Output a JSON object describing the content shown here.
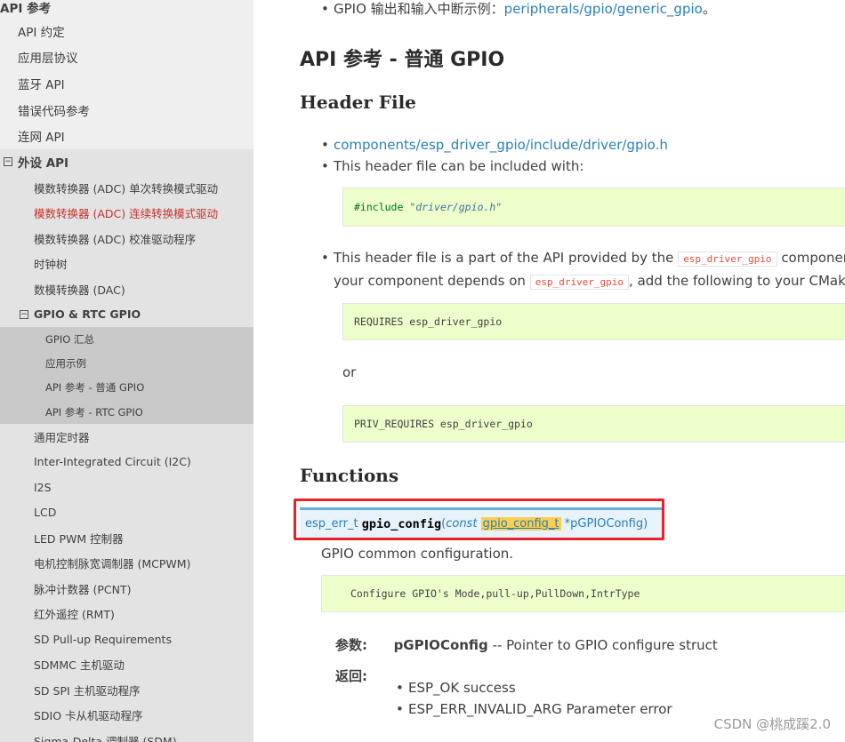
{
  "sidebar": {
    "top_item": "API 参考",
    "items_l1": [
      "API 约定",
      "应用层协议",
      "蓝牙 API",
      "错误代码参考",
      "连网 API"
    ],
    "expanded_l1": {
      "toggle": "⊟",
      "label": "外设 API"
    },
    "items_l2_before": [
      "模数转换器 (ADC) 单次转换模式驱动",
      "模数转换器 (ADC) 连续转换模式驱动",
      "模数转换器 (ADC) 校准驱动程序",
      "时钟树",
      "数模转换器 (DAC)"
    ],
    "expanded_l2": {
      "toggle": "⊟",
      "label": "GPIO & RTC GPIO"
    },
    "items_l3": [
      "GPIO 汇总",
      "应用示例",
      "API 参考 - 普通 GPIO",
      "API 参考 - RTC GPIO"
    ],
    "items_l2_after": [
      "通用定时器",
      "Inter-Integrated Circuit (I2C)",
      "I2S",
      "LCD",
      "LED PWM 控制器",
      "电机控制脉宽调制器 (MCPWM)",
      "脉冲计数器 (PCNT)",
      "红外遥控 (RMT)",
      "SD Pull-up Requirements",
      "SDMMC 主机驱动",
      "SD SPI 主机驱动程序",
      "SDIO 卡从机驱动程序",
      "Sigma-Delta 调制器 (SDM)"
    ]
  },
  "main": {
    "top_bullet_text": "GPIO 输出和输入中断示例：",
    "top_bullet_link": "peripherals/gpio/generic_gpio",
    "top_bullet_suffix": "。",
    "page_title": "API 参考 - 普通 GPIO",
    "header_file_heading": "Header File",
    "header_link": "components/esp_driver_gpio/include/driver/gpio.h",
    "include_intro": "This header file can be included with:",
    "include_directive": "#include",
    "include_path": "\"driver/gpio.h\"",
    "part_of_text_1": "This header file is a part of the API provided by the",
    "component_code": "esp_driver_gpio",
    "part_of_text_2": "component. To d",
    "depends_text_1": "your component depends on",
    "depends_text_2": ", add the following to your CMakeLists.",
    "requires_line": "REQUIRES esp_driver_gpio",
    "or_text": "or",
    "priv_requires_line": "PRIV_REQUIRES esp_driver_gpio",
    "functions_heading": "Functions",
    "signature": {
      "return_type": "esp_err_t",
      "name": "gpio_config",
      "open_paren": "(",
      "qualifier": "const",
      "param_type": "gpio_config_t",
      "param_name": "*pGPIOConfig",
      "close_paren": ")"
    },
    "description": "GPIO common configuration.",
    "code_comment": "Configure GPIO's Mode,pull-up,PullDown,IntrType",
    "params_label": "参数:",
    "param_name_bold": "pGPIOConfig",
    "param_desc": " -- Pointer to GPIO configure struct",
    "returns_label": "返回:",
    "returns": [
      "ESP_OK success",
      "ESP_ERR_INVALID_ARG Parameter error"
    ]
  },
  "watermark": "CSDN @桃成蹊2.0",
  "colors": {
    "link": "#2980b9",
    "highlight_border": "#e8212b",
    "code_bg": "#eeffcc",
    "active_nav": "#c9302c"
  }
}
